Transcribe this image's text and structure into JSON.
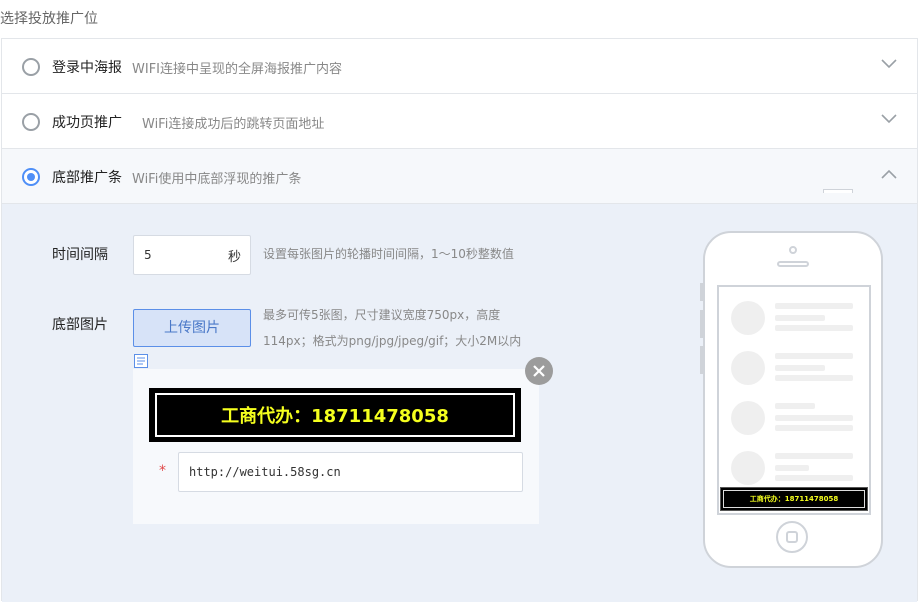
{
  "section_label": "选择投放推广位",
  "options": [
    {
      "title": "登录中海报",
      "desc": "WIFI连接中呈现的全屏海报推广内容",
      "selected": false
    },
    {
      "title": "成功页推广",
      "desc": "WiFi连接成功后的跳转页面地址",
      "selected": false
    },
    {
      "title": "底部推广条",
      "desc": "WiFi使用中底部浮现的推广条",
      "selected": true
    }
  ],
  "interval": {
    "label": "时间间隔",
    "value": "5",
    "unit": "秒",
    "hint": "设置每张图片的轮播时间间隔，1～10秒整数值"
  },
  "images": {
    "label": "底部图片",
    "upload_label": "上传图片",
    "hint_line1": "最多可传5张图，尺寸建议宽度750px，高度",
    "hint_line2": "114px；格式为png/jpg/jpeg/gif；大小2M以内",
    "banner_text": "工商代办：18711478058",
    "required_mark": "*",
    "url_value": "http://weitui.58sg.cn"
  },
  "preview": {
    "banner_text": "工商代办：18711478058"
  },
  "colors": {
    "accent": "#4f8ff7",
    "banner_bg": "#000000",
    "banner_text": "#f5ff1e",
    "panel_bg": "#ebf0f8"
  },
  "icons": {
    "chevron_down": "chevron-down-icon",
    "chevron_up": "chevron-up-icon",
    "close": "close-icon",
    "document": "document-icon"
  }
}
